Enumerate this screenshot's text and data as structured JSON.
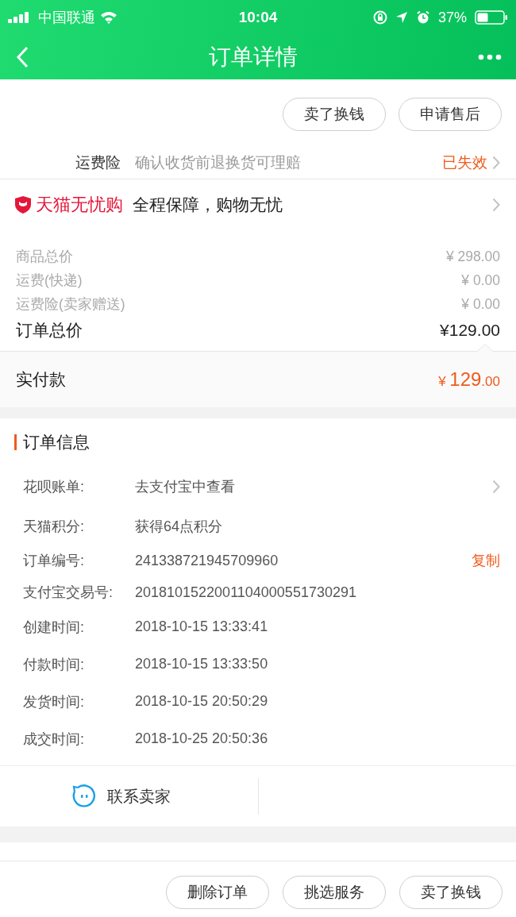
{
  "status_bar": {
    "carrier": "中国联通",
    "time": "10:04",
    "battery": "37%"
  },
  "nav": {
    "title": "订单详情"
  },
  "top_actions": [
    "卖了换钱",
    "申请售后"
  ],
  "freight_insurance": {
    "label": "运费险",
    "description": "确认收货前退换货可理赔",
    "status": "已失效"
  },
  "guarantee": {
    "brand": "天猫无忧购",
    "text": "全程保障，购物无忧"
  },
  "price_lines": [
    {
      "label": "商品总价",
      "amount": "¥ 298.00",
      "kind": "minor"
    },
    {
      "label": "运费(快递)",
      "amount": "¥ 0.00",
      "kind": "minor"
    },
    {
      "label": "运费险(卖家赠送)",
      "amount": "¥ 0.00",
      "kind": "minor"
    },
    {
      "label": "订单总价",
      "amount": "¥129.00",
      "kind": "total"
    }
  ],
  "paid": {
    "label": "实付款",
    "currency": "¥",
    "integer": "129",
    "decimal": ".00"
  },
  "order_info": {
    "title": "订单信息",
    "rows": [
      {
        "label": "花呗账单:",
        "value": "去支付宝中查看",
        "kind": "link"
      },
      {
        "label": "天猫积分:",
        "value": "获得64点积分",
        "kind": "plain"
      },
      {
        "label": "订单编号:",
        "value": "241338721945709960",
        "kind": "copy",
        "action": "复制"
      },
      {
        "label": "支付宝交易号:",
        "value": "2018101522001104000551730291",
        "kind": "plain"
      },
      {
        "label": "创建时间:",
        "value": "2018-10-15 13:33:41",
        "kind": "plain"
      },
      {
        "label": "付款时间:",
        "value": "2018-10-15 13:33:50",
        "kind": "plain"
      },
      {
        "label": "发货时间:",
        "value": "2018-10-15 20:50:29",
        "kind": "plain"
      },
      {
        "label": "成交时间:",
        "value": "2018-10-25 20:50:36",
        "kind": "plain"
      }
    ]
  },
  "contact": {
    "label": "联系卖家"
  },
  "bottom_actions": [
    "删除订单",
    "挑选服务",
    "卖了换钱"
  ]
}
